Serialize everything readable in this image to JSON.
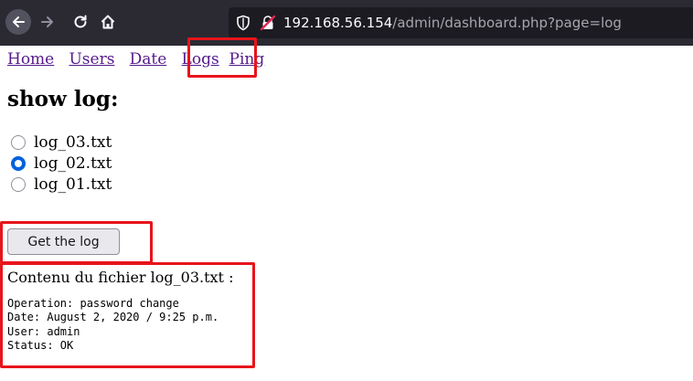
{
  "browser": {
    "url_host": "192.168.56.154",
    "url_path": "/admin/dashboard.php?page=log"
  },
  "menu": {
    "items": [
      {
        "label": "Home"
      },
      {
        "label": "Users"
      },
      {
        "label": "Date"
      },
      {
        "label": "Logs"
      },
      {
        "label": "Ping"
      }
    ]
  },
  "page": {
    "title": "show log:",
    "files": [
      {
        "label": "log_03.txt",
        "checked": false
      },
      {
        "label": "log_02.txt",
        "checked": true
      },
      {
        "label": "log_01.txt",
        "checked": false
      }
    ],
    "button_label": "Get the log",
    "content_title": "Contenu du fichier log_03.txt :",
    "log_lines": [
      "Operation: password change",
      "Date: August 2, 2020 / 9:25 p.m.",
      "User: admin",
      "Status: OK"
    ]
  },
  "colors": {
    "toolbar_bg": "#2b2a33",
    "urlbar_bg": "#1c1b22",
    "link": "#551a8b",
    "radio_checked": "#0061e0",
    "annotation": "#e8141b"
  }
}
